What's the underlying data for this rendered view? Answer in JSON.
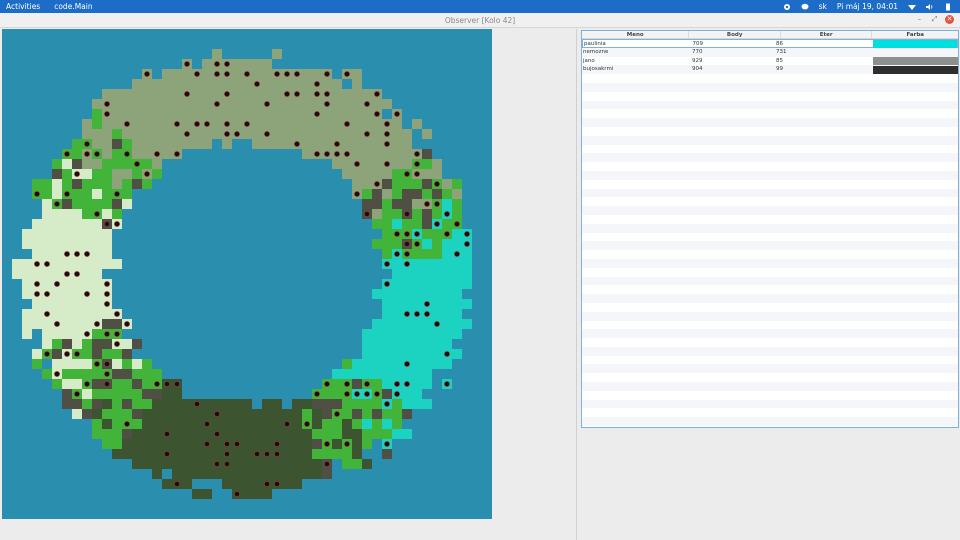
{
  "topbar": {
    "activities": "Activities",
    "app": "code.Main",
    "lang": "sk",
    "clock": "Pi máj 19, 04:01",
    "icons": [
      "settings-icon",
      "chat-icon",
      "wifi-icon",
      "volume-icon",
      "battery-icon"
    ]
  },
  "window": {
    "title": "Observer [Kolo 42]",
    "controls": {
      "minimize": "–",
      "maximize": "⤢",
      "close": "✕"
    }
  },
  "table": {
    "headers": [
      "Meno",
      "Body",
      "Eter",
      "Farba"
    ],
    "rows": [
      {
        "name": "paulinia",
        "body": "709",
        "eter": "86",
        "color": "#00dede"
      },
      {
        "name": "nemozne",
        "body": "770",
        "eter": "731",
        "color": ""
      },
      {
        "name": "jano",
        "body": "929",
        "eter": "85",
        "color": "#8f8f8f"
      },
      {
        "name": "bujosakrmi",
        "body": "904",
        "eter": "99",
        "color": "#2e2e2e"
      }
    ],
    "empty_rows": 40
  },
  "map": {
    "colors": {
      "water": "#2a8fae",
      "north": "#8da37a",
      "east": "#1bd3c0",
      "south": "#3d5430",
      "west": "#d6ecc8",
      "grass": "#43b43a",
      "rock": "#4f4f44",
      "unit": "#111111"
    }
  }
}
